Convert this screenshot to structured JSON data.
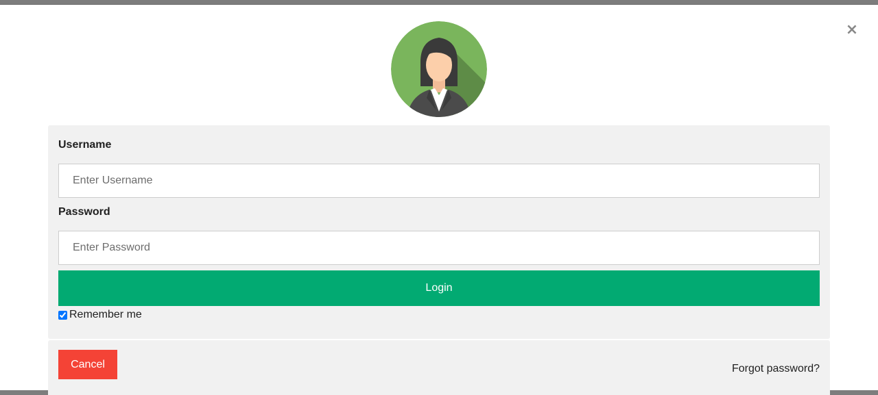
{
  "dialog": {
    "close_label": "×"
  },
  "avatar": {
    "icon": "female-avatar-icon",
    "colors": {
      "circle": "#7ab55c",
      "shadow": "#5e8c47",
      "hair": "#3a3a3a",
      "skin": "#fccfaa",
      "suit": "#4b4b4b",
      "shirt": "#ffffff"
    }
  },
  "form": {
    "username_label": "Username",
    "username_placeholder": "Enter Username",
    "username_value": "",
    "password_label": "Password",
    "password_placeholder": "Enter Password",
    "password_value": "",
    "login_label": "Login",
    "remember_label": "Remember me",
    "remember_checked": true
  },
  "footer": {
    "cancel_label": "Cancel",
    "forgot_label": "Forgot password?"
  },
  "colors": {
    "login_button": "#02aa72",
    "cancel_button": "#f44336",
    "panel_background": "#f1f1f1"
  }
}
